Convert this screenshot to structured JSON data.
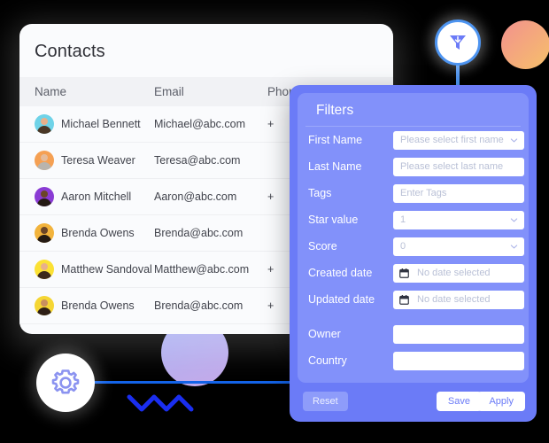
{
  "contacts_card": {
    "title": "Contacts",
    "columns": [
      "Name",
      "Email",
      "Phone Number"
    ],
    "rows": [
      {
        "name": "Michael Bennett",
        "email": "Michael@abc.com",
        "phone": "+",
        "avatar_color": "#6fd3e8",
        "skin": "#e8b08a",
        "hair": "#4a3726"
      },
      {
        "name": "Teresa Weaver",
        "email": "Teresa@abc.com",
        "phone": "",
        "avatar_color": "#f5a053",
        "skin": "#e5bb9a",
        "hair": "#b9b4ad"
      },
      {
        "name": "Aaron Mitchell",
        "email": "Aaron@abc.com",
        "phone": "+",
        "avatar_color": "#8a3bd4",
        "skin": "#6b4527",
        "hair": "#241a13"
      },
      {
        "name": "Brenda Owens",
        "email": "Brenda@abc.com",
        "phone": "",
        "avatar_color": "#f2b33c",
        "skin": "#6b4527",
        "hair": "#241a13"
      },
      {
        "name": "Matthew Sandoval",
        "email": "Matthew@abc.com",
        "phone": "+",
        "avatar_color": "#fbe134",
        "skin": "#e8b08a",
        "hair": "#3d2a1c"
      },
      {
        "name": "Brenda Owens",
        "email": "Brenda@abc.com",
        "phone": "+",
        "avatar_color": "#f5d634",
        "skin": "#c98f5e",
        "hair": "#2e1f16"
      }
    ]
  },
  "filters_panel": {
    "heading": "Filters",
    "fields": [
      {
        "label": "First Name",
        "placeholder": "Please select first name",
        "value": "",
        "control": "select"
      },
      {
        "label": "Last Name",
        "placeholder": "Please select last name",
        "value": "",
        "control": "text"
      },
      {
        "label": "Tags",
        "placeholder": "Enter Tags",
        "value": "",
        "control": "text"
      },
      {
        "label": "Star value",
        "placeholder": "",
        "value": "1",
        "control": "select"
      },
      {
        "label": "Score",
        "placeholder": "",
        "value": "0",
        "control": "select"
      },
      {
        "label": "Created date",
        "placeholder": "No date selected",
        "value": "",
        "control": "date"
      },
      {
        "label": "Updated date",
        "placeholder": "No date selected",
        "value": "",
        "control": "date"
      },
      {
        "label": "Owner",
        "placeholder": "",
        "value": "",
        "control": "text"
      },
      {
        "label": "Country",
        "placeholder": "",
        "value": "",
        "control": "text"
      }
    ],
    "reset_label": "Reset",
    "save_label": "Save",
    "apply_label": "Apply"
  },
  "decorations": {
    "funnel_icon": "funnel-icon",
    "gear_icon": "gear-icon",
    "accent_indigo": "#6b7bf7",
    "accent_blue": "#1363e8"
  }
}
